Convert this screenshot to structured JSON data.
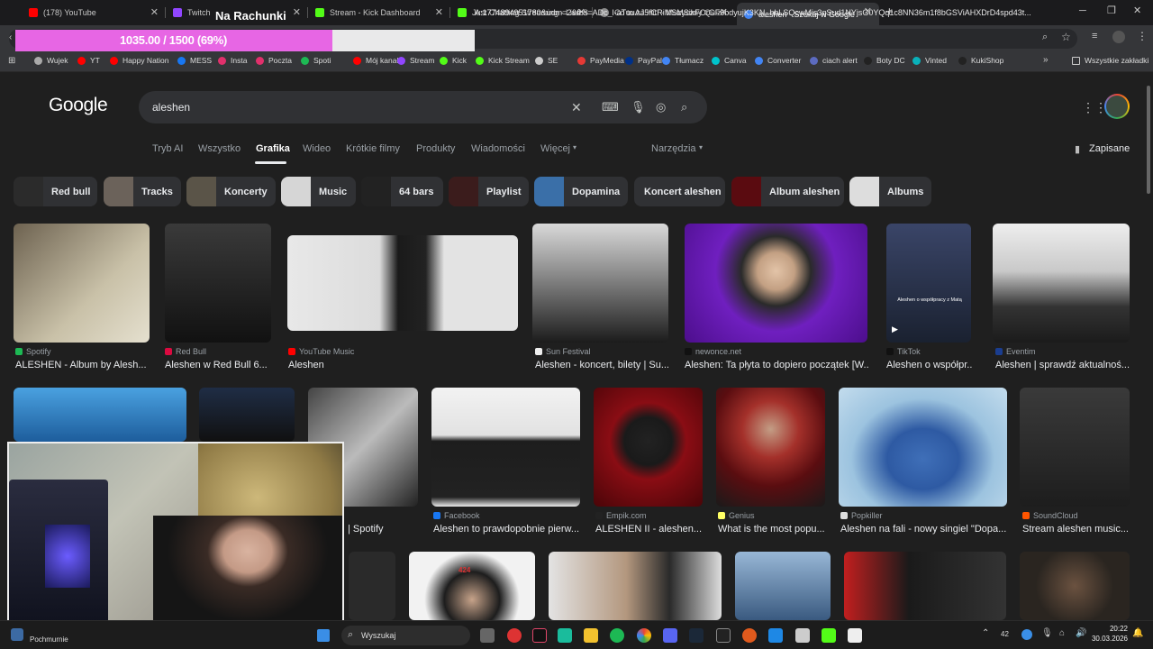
{
  "overlay": {
    "title": "Na Rachunki",
    "progress_label": "1035.00 / 1500 (69%)",
    "progress_fraction": 0.69
  },
  "tabs": [
    {
      "label": "(178) YouTube",
      "color": "#ff0000"
    },
    {
      "label": "Twitch",
      "color": "#9146ff"
    },
    {
      "label": "Stream - Kick Dashboard",
      "color": "#53fc18"
    },
    {
      "label": "Just Chatting Streaming - Live S",
      "color": "#53fc18"
    },
    {
      "label": "Co to za Hit! - Muzyczny Quiz",
      "color": "#8e8e8e"
    },
    {
      "label": "aleshen - Szukaj w Google",
      "color": "#4285f4"
    }
  ],
  "url": "A:1774894951780&udm=2&fbs=ADc_l-aTuuAJ5fCRiMSMSikFOrGF6bdyujK3KN_bbLSQcwMis3qSud1NYjsG0YQq1c8NN36m1f8bGSViAHXDrD4spd43t...",
  "bookmarks": [
    {
      "label": "Wujek",
      "color": "#aaa"
    },
    {
      "label": "YT",
      "color": "#ff0000"
    },
    {
      "label": "Happy Nation",
      "color": "#ff0000"
    },
    {
      "label": "MESS",
      "color": "#1877f2"
    },
    {
      "label": "Insta",
      "color": "#e1306c"
    },
    {
      "label": "Poczta",
      "color": "#e1306c"
    },
    {
      "label": "Spoti",
      "color": "#1db954"
    },
    {
      "label": "Mój kanał",
      "color": "#ff0000"
    },
    {
      "label": "Stream",
      "color": "#9146ff"
    },
    {
      "label": "Kick",
      "color": "#53fc18"
    },
    {
      "label": "Kick Stream",
      "color": "#53fc18"
    },
    {
      "label": "SE",
      "color": "#ccc"
    },
    {
      "label": "PayMedia",
      "color": "#e53935"
    },
    {
      "label": "PayPal",
      "color": "#003087"
    },
    {
      "label": "Tłumacz",
      "color": "#4285f4"
    },
    {
      "label": "Canva",
      "color": "#00c4cc"
    },
    {
      "label": "Converter",
      "color": "#4285f4"
    },
    {
      "label": "ciach alert",
      "color": "#5c6bc0"
    },
    {
      "label": "Boty DC",
      "color": "#222"
    },
    {
      "label": "Vinted",
      "color": "#09b1ba"
    },
    {
      "label": "KukiShop",
      "color": "#222"
    }
  ],
  "bookmarks_all": "Wszystkie zakładki",
  "google": {
    "logo": "Google",
    "query": "aleshen",
    "saved": "Zapisane",
    "tools": "Narzędzia",
    "nav": [
      "Tryb AI",
      "Wszystko",
      "Grafika",
      "Wideo",
      "Krótkie filmy",
      "Produkty",
      "Wiadomości",
      "Więcej"
    ],
    "chips": [
      "Red bull",
      "Tracks",
      "Koncerty",
      "Music",
      "64 bars",
      "Playlist",
      "Dopamina",
      "Koncert aleshen",
      "Album aleshen",
      "Albums"
    ]
  },
  "results_row1": [
    {
      "source": "Spotify",
      "title": "ALESHEN - Album by Alesh...",
      "color": "#1db954"
    },
    {
      "source": "Red Bull",
      "title": "Aleshen w Red Bull 6...",
      "color": "#db0a40"
    },
    {
      "source": "YouTube Music",
      "title": "Aleshen",
      "color": "#ff0000"
    },
    {
      "source": "Sun Festival",
      "title": "Aleshen - koncert, bilety | Su...",
      "color": "#eee"
    },
    {
      "source": "newonce.net",
      "title": "Aleshen: Ta płyta to dopiero początek [W...",
      "color": "#111"
    },
    {
      "source": "TikTok",
      "title": "Aleshen o współpr...",
      "color": "#111"
    },
    {
      "source": "Eventim",
      "title": "Aleshen | sprawdź aktualnoś...",
      "color": "#1a3d8f"
    }
  ],
  "results_row2": [
    {
      "source": "",
      "title": "| Spotify",
      "color": "#1db954"
    },
    {
      "source": "Facebook",
      "title": "Aleshen to prawdopobnie pierw...",
      "color": "#1877f2"
    },
    {
      "source": "Empik.com",
      "title": "ALESHEN II - aleshen...",
      "color": "#222"
    },
    {
      "source": "Genius",
      "title": "What is the most popu...",
      "color": "#ffff64"
    },
    {
      "source": "Popkiller",
      "title": "Aleshen na fali - nowy singiel \"Dopa...",
      "color": "#ddd"
    },
    {
      "source": "SoundCloud",
      "title": "Stream aleshen music...",
      "color": "#ff5500"
    }
  ],
  "image_text": {
    "tiktok_caption": "Aleshen o współpracy z Matą"
  },
  "taskbar": {
    "weather": "Pochmurnie",
    "search": "Wyszukaj",
    "badge": "42",
    "time": "20:22",
    "date": "30.03.2026"
  }
}
